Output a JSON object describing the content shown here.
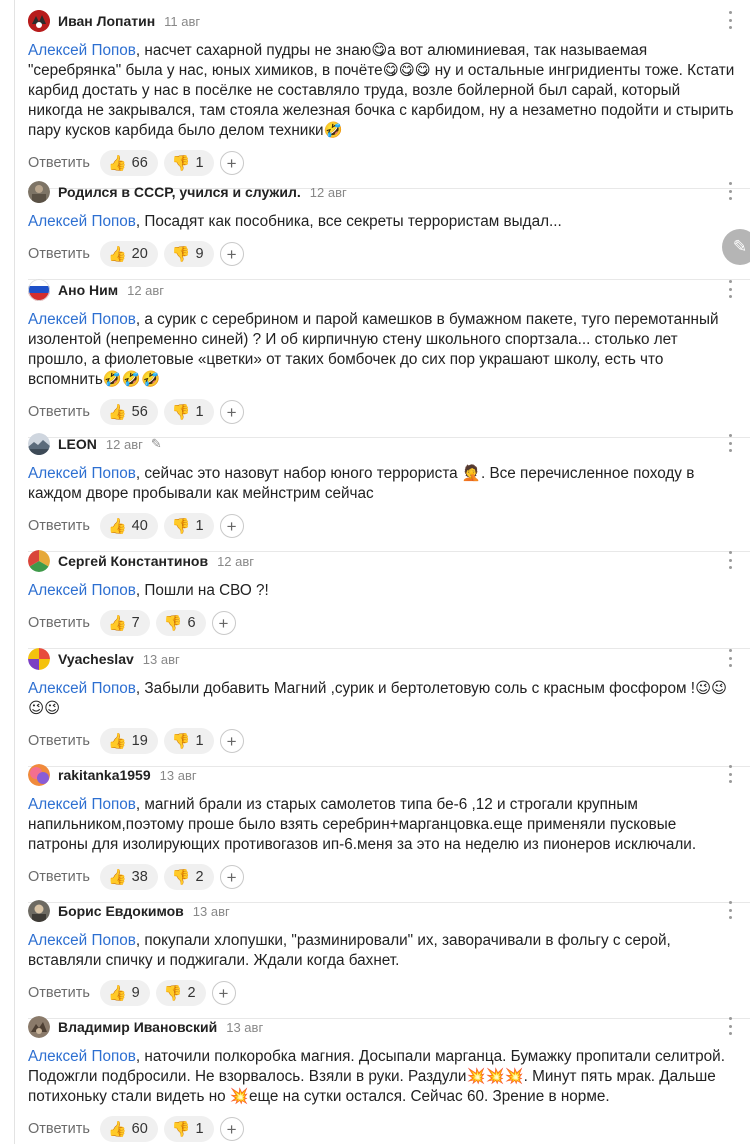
{
  "reply_label": "Ответить",
  "comments": [
    {
      "author": "Иван Лопатин",
      "date": "11 авг",
      "mention": "Алексей Попов",
      "text": ", насчет сахарной пудры не знаю😋а вот алюминиевая, так называемая \"серебрянка\" была у нас, юных химиков, в почёте😋😋😋 ну и остальные ингридиенты тоже. Кстати карбид достать у нас в посёлке не составляло труда, возле бойлерной был сарай, который никогда не закрывался, там стояла железная бочка с карбидом, ну а незаметно подойти и стырить пару кусков карбида было делом техники🤣",
      "likes": "66",
      "dislikes": "1"
    },
    {
      "author": "Родился в СССР, учился и служил.",
      "date": "12 авг",
      "mention": "Алексей Попов",
      "text": ", Посадят как пособника, все секреты террористам выдал...",
      "likes": "20",
      "dislikes": "9"
    },
    {
      "author": "Ано Ним",
      "date": "12 авг",
      "mention": "Алексей Попов",
      "text": ", а сурик с серебрином и парой камешков в бумажном пакете, туго перемотанный изолентой (непременно синей) ? И об кирпичную стену школьного спортзала... столько лет прошло, а фиолетовые «цветки» от таких бомбочек до сих пор украшают школу, есть что вспомнить🤣🤣🤣",
      "likes": "56",
      "dislikes": "1"
    },
    {
      "author": "LEON",
      "date": "12 авг",
      "mention": "Алексей Попов",
      "text": ", сейчас это назовут набор юного террориста 🤦. Все перечисленное походу в каждом дворе пробывали как мейнстрим сейчас",
      "likes": "40",
      "dislikes": "1"
    },
    {
      "author": "Сергей Константинов",
      "date": "12 авг",
      "mention": "Алексей Попов",
      "text": ", Пошли на СВО ?!",
      "likes": "7",
      "dislikes": "6"
    },
    {
      "author": "Vyacheslav",
      "date": "13 авг",
      "mention": "Алексей Попов",
      "text": ", Забыли добавить Магний ,сурик и бертолетовую соль с красным фосфором !😉😉😉😉",
      "likes": "19",
      "dislikes": "1"
    },
    {
      "author": "rakitanka1959",
      "date": "13 авг",
      "mention": "Алексей Попов",
      "text": ", магний брали из старых самолетов типа бе-6 ,12 и строгали крупным напильником,поэтому проше было взять серебрин+марганцовка.еще применяли пусковые патроны для изолирующих противогазов ип-6.меня за это на неделю из пионеров исключали.",
      "likes": "38",
      "dislikes": "2"
    },
    {
      "author": "Борис Евдокимов",
      "date": "13 авг",
      "mention": "Алексей Попов",
      "text": ", покупали хлопушки, \"разминировали\" их, заворачивали в фольгу с серой, вставляли спичку и поджигали. Ждали когда бахнет.",
      "likes": "9",
      "dislikes": "2"
    },
    {
      "author": "Владимир Ивановский",
      "date": "13 авг",
      "mention": "Алексей Попов",
      "text": ", наточили полкоробка магния. Досыпали марганца. Бумажку пропитали селитрой. Подожгли подбросили. Не взорвалось. Взяли в руки. Раздули💥💥💥. Минут пять мрак. Дальше потихоньку стали видеть но 💥еще на сутки остался. Сейчас 60. Зрение в норме.",
      "likes": "60",
      "dislikes": "1"
    }
  ],
  "icons": {
    "like": "thumbs-up-icon",
    "dislike": "thumbs-down-icon",
    "add_reaction": "plus-icon",
    "more": "more-vertical-icon",
    "edit": "pencil-icon",
    "fab": "pencil-icon"
  },
  "colors": {
    "mention": "#2d6fd1",
    "pill_bg": "#f0f0f0",
    "dislike": "#d64545"
  }
}
